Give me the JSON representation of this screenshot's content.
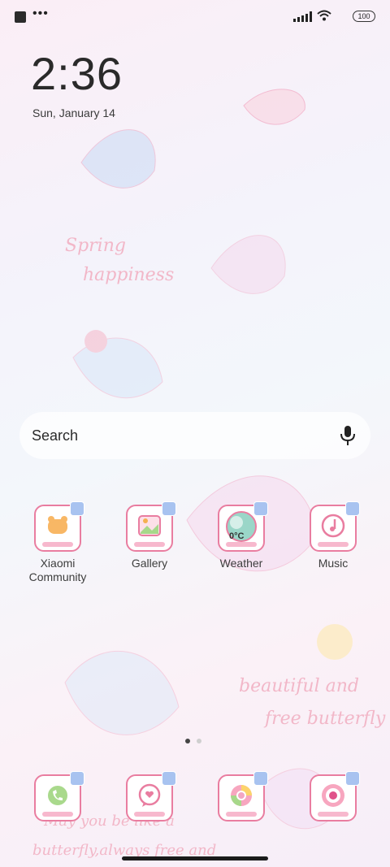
{
  "status_bar": {
    "battery": "100"
  },
  "clock": {
    "time": "2:36",
    "date": "Sun, January 14"
  },
  "wallpaper": {
    "text1": "Spring",
    "text2": "happiness",
    "text3": "beautiful and",
    "text4": "free butterfly",
    "text5": "May you be like a",
    "text6": "butterfly,always free and"
  },
  "search": {
    "label": "Search"
  },
  "apps": [
    {
      "label": "Xiaomi Community"
    },
    {
      "label": "Gallery"
    },
    {
      "label": "Weather",
      "temp": "0°C"
    },
    {
      "label": "Music"
    }
  ],
  "dock": [
    {
      "name": "phone"
    },
    {
      "name": "messages"
    },
    {
      "name": "chrome"
    },
    {
      "name": "camera"
    }
  ],
  "colors": {
    "accent": "#e97da0",
    "badge": "#a8c3f0"
  }
}
